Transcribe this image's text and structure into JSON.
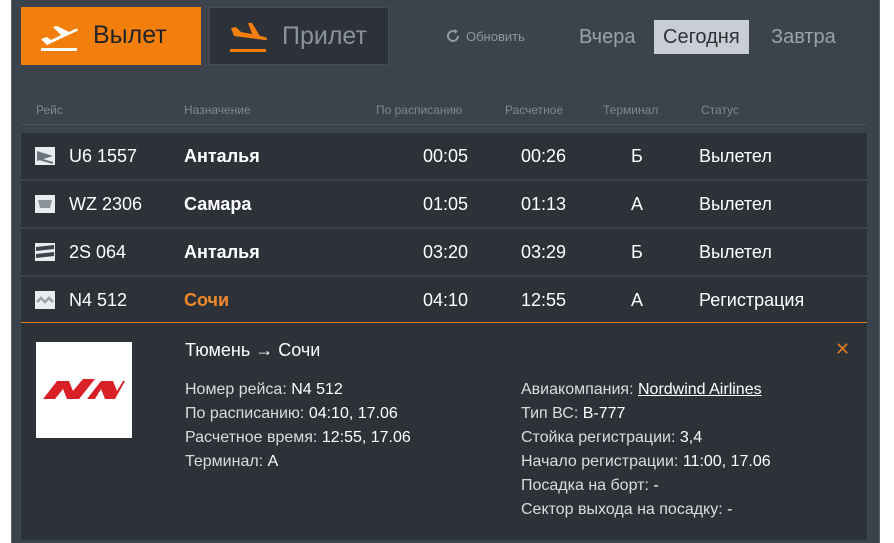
{
  "tabs": {
    "departures": "Вылет",
    "arrivals": "Прилет"
  },
  "refresh_label": "Обновить",
  "days": {
    "yesterday": "Вчера",
    "today": "Сегодня",
    "tomorrow": "Завтра"
  },
  "columns": {
    "flight": "Рейс",
    "destination": "Назначение",
    "scheduled": "По расписанию",
    "estimated": "Расчетное",
    "terminal": "Терминал",
    "status": "Статус"
  },
  "flights": [
    {
      "number": "U6 1557",
      "destination": "Анталья",
      "scheduled": "00:05",
      "estimated": "00:26",
      "terminal": "Б",
      "status": "Вылетел"
    },
    {
      "number": "WZ 2306",
      "destination": "Самара",
      "scheduled": "01:05",
      "estimated": "01:13",
      "terminal": "А",
      "status": "Вылетел"
    },
    {
      "number": "2S 064",
      "destination": "Анталья",
      "scheduled": "03:20",
      "estimated": "03:29",
      "terminal": "Б",
      "status": "Вылетел"
    },
    {
      "number": "N4 512",
      "destination": "Сочи",
      "scheduled": "04:10",
      "estimated": "12:55",
      "terminal": "А",
      "status": "Регистрация"
    }
  ],
  "detail": {
    "route": "Тюмень → Сочи",
    "flight_number_label": "Номер рейса:",
    "flight_number": "N4 512",
    "scheduled_label": "По расписанию:",
    "scheduled": "04:10, 17.06",
    "estimated_label": "Расчетное время:",
    "estimated": "12:55, 17.06",
    "terminal_label": "Терминал:",
    "terminal": "А",
    "airline_label": "Авиакомпания:",
    "airline": "Nordwind Airlines",
    "aircraft_label": "Тип ВС:",
    "aircraft": "B-777",
    "checkin_desk_label": "Стойка регистрации:",
    "checkin_desk": "3,4",
    "checkin_start_label": "Начало регистрации:",
    "checkin_start": "11:00, 17.06",
    "boarding_label": "Посадка на борт:",
    "boarding": "-",
    "gate_label": "Сектор выхода на посадку:",
    "gate": "-"
  },
  "colors": {
    "accent": "#f27f0c",
    "panel": "#2c3238",
    "background": "#3b434c",
    "nordwind_red": "#d92027"
  }
}
